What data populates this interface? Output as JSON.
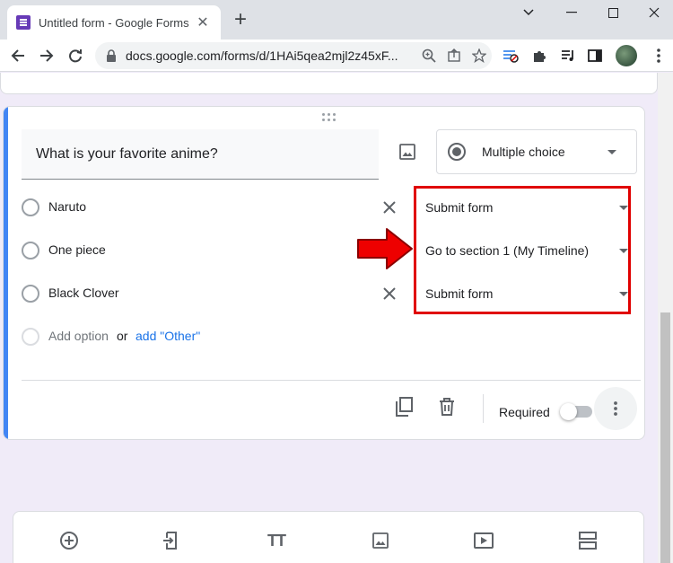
{
  "browser": {
    "tab_title": "Untitled form - Google Forms",
    "url": "docs.google.com/forms/d/1HAi5qea2mjl2z45xF..."
  },
  "question": {
    "title": "What is your favorite anime?",
    "type_label": "Multiple choice",
    "options": [
      {
        "label": "Naruto",
        "goto": "Submit form",
        "removable": true
      },
      {
        "label": "One piece",
        "goto": "Go to section 1 (My Timeline)",
        "removable": false
      },
      {
        "label": "Black Clover",
        "goto": "Submit form",
        "removable": true
      }
    ],
    "add_option": "Add option",
    "or_text": "or",
    "add_other": "add \"Other\"",
    "required_label": "Required",
    "required_on": false
  },
  "colors": {
    "accent": "#4285f4",
    "forms_purple": "#673ab7",
    "annotation_red": "#e00000",
    "link_blue": "#1a73e8"
  }
}
